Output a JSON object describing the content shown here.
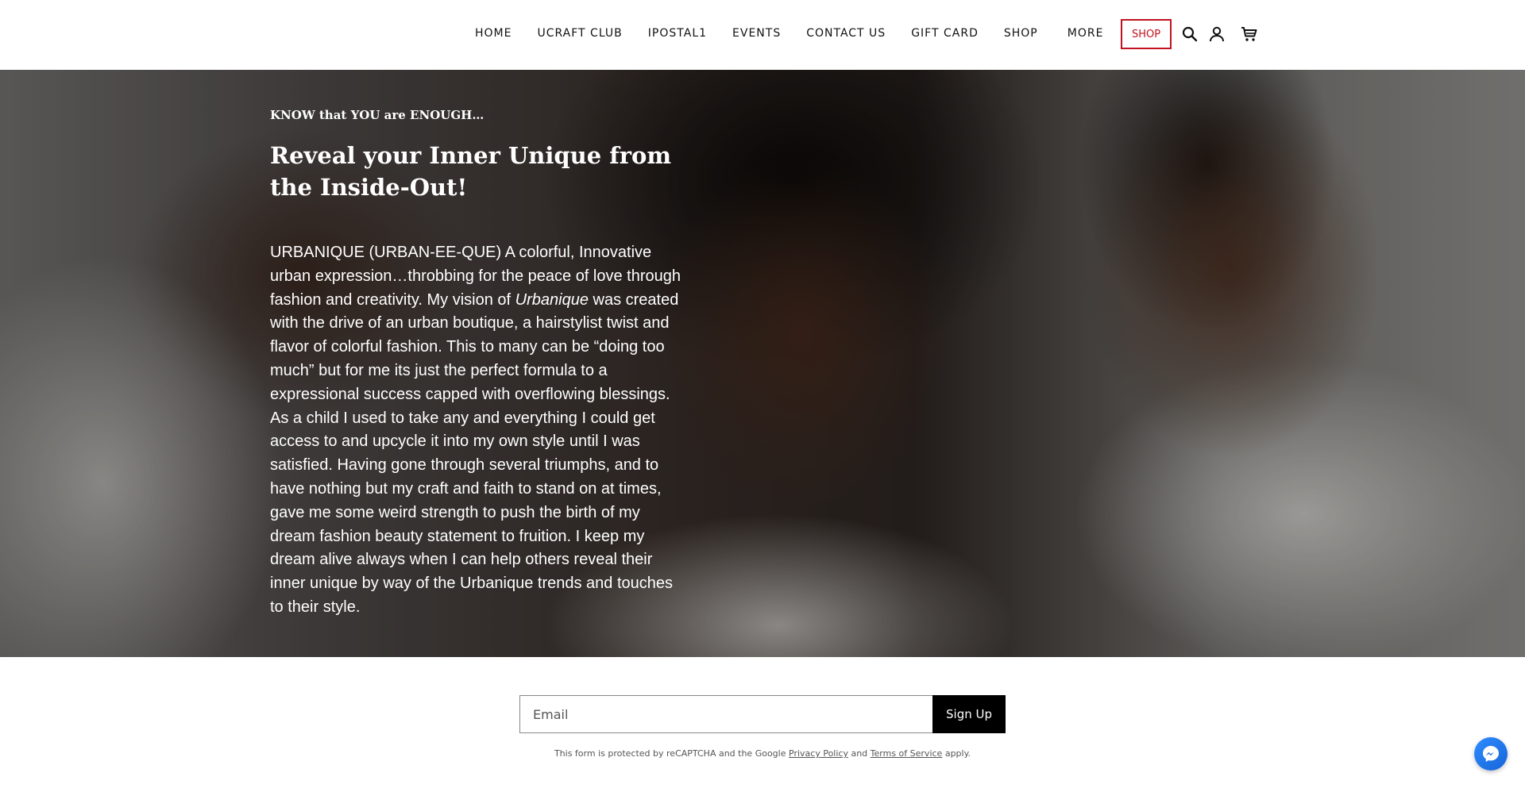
{
  "nav": {
    "items": [
      "HOME",
      "UCRAFT CLUB",
      "IPOSTAL1",
      "EVENTS",
      "CONTACT US",
      "GIFT CARD",
      "SHOP"
    ],
    "more_label": "MORE",
    "shop_button_label": "SHOP",
    "icons": [
      "search-icon",
      "user-icon",
      "cart-icon"
    ],
    "accent_color": "#c1121f"
  },
  "hero": {
    "eyebrow": "KNOW that YOU are ENOUGH…",
    "headline": "Reveal your Inner Unique from the Inside-Out!",
    "body_part1": "URBANIQUE (URBAN-EE-QUE) A colorful, Innovative urban expression…throbbing for the peace of love through fashion and creativity. My vision of ",
    "body_emphasis": "Urbanique",
    "body_part2": " was created with the drive of an urban boutique, a hairstylist twist and flavor of colorful fashion. This to many can be “doing too much” but for me its just the perfect formula to a expressional success capped with overflowing blessings. As a child I used to take any and everything I could get access to and upcycle it into my own style until I was satisfied. Having gone through several triumphs, and to have nothing but my craft and faith to stand on at times, gave me some weird strength to push the birth of my dream fashion beauty statement to fruition. I keep my dream alive always when I can help others reveal their inner unique by way of the Urbanique trends and touches to their style."
  },
  "signup": {
    "email_placeholder": "Email",
    "button_label": "Sign Up"
  },
  "legal": {
    "prefix": "This form is protected by reCAPTCHA and the Google ",
    "privacy_link": "Privacy Policy",
    "middle": " and ",
    "terms_link": "Terms of Service",
    "suffix": " apply."
  },
  "widgets": {
    "chat_icon": "messenger-icon"
  }
}
